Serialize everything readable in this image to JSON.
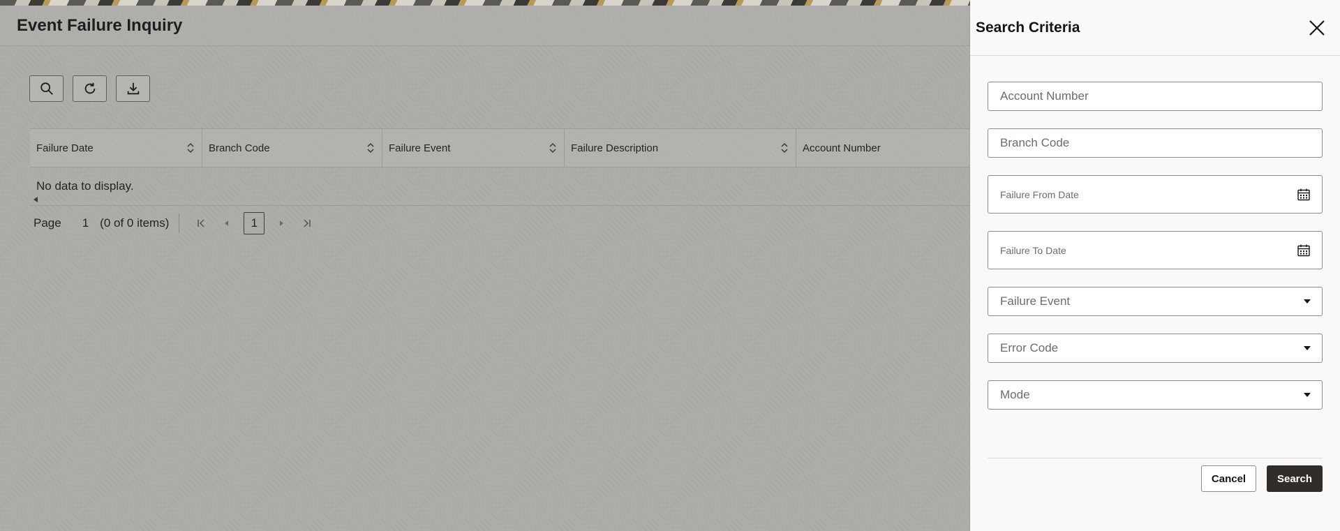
{
  "page": {
    "title": "Event Failure Inquiry"
  },
  "toolbar": {
    "buttons": [
      {
        "icon": "search-icon"
      },
      {
        "icon": "refresh-icon"
      },
      {
        "icon": "download-icon"
      }
    ]
  },
  "grid": {
    "columns": [
      "Failure Date",
      "Branch Code",
      "Failure Event",
      "Failure Description",
      "Account Number"
    ],
    "empty_message": "No data to display."
  },
  "pagination": {
    "page_label": "Page",
    "page_number": "1",
    "items_summary": "(0 of 0 items)",
    "current_page": "1"
  },
  "drawer": {
    "title": "Search Criteria",
    "fields": {
      "account_number": "Account Number",
      "branch_code": "Branch Code",
      "failure_from_date": "Failure From Date",
      "failure_to_date": "Failure To Date",
      "failure_event": "Failure Event",
      "error_code": "Error Code",
      "mode": "Mode"
    },
    "cancel_label": "Cancel",
    "search_label": "Search"
  },
  "colors": {
    "primary_button": "#312d2a",
    "overlay": "#adaca9",
    "drawer_bg": "#fbf9f8"
  }
}
